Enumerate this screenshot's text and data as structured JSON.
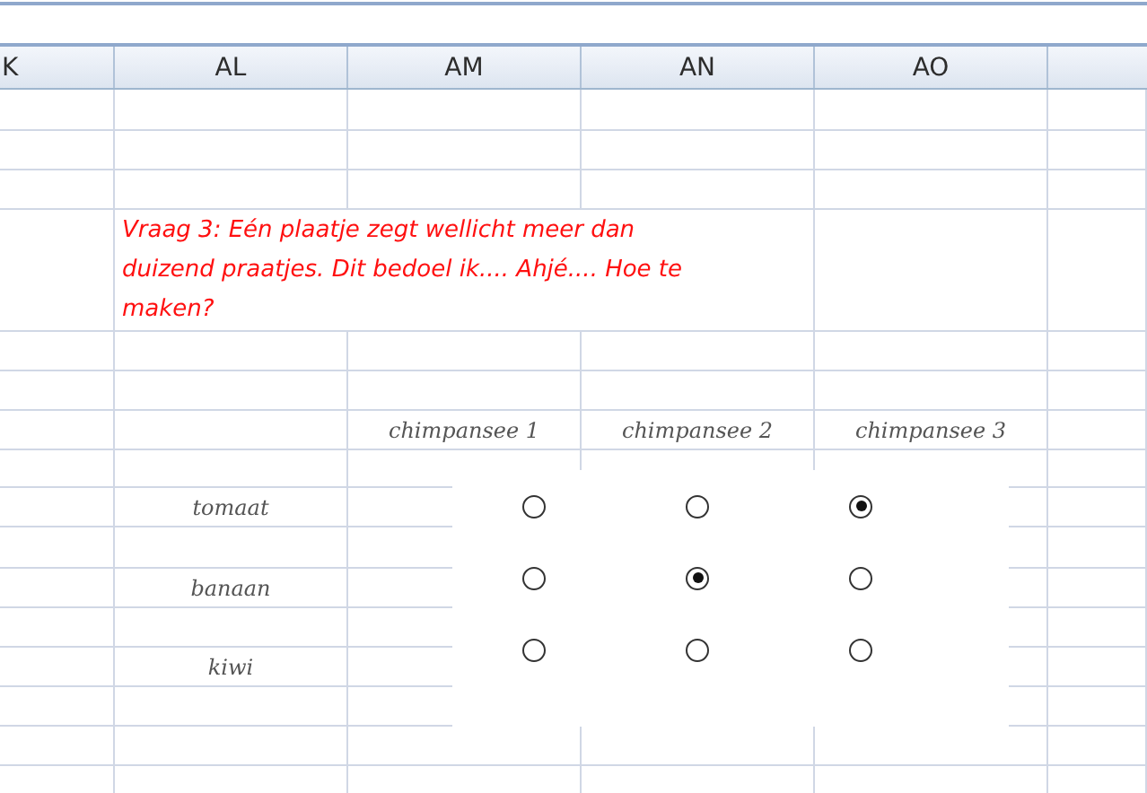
{
  "columns": [
    {
      "label": "K"
    },
    {
      "label": "AL"
    },
    {
      "label": "AM"
    },
    {
      "label": "AN"
    },
    {
      "label": "AO"
    }
  ],
  "question": "Vraag 3: Eén plaatje zegt wellicht meer dan duizend praatjes. Dit bedoel ik.... Ahjé.... Hoe te maken?",
  "option_headers": [
    "chimpansee 1",
    "chimpansee 2",
    "chimpansee 3"
  ],
  "items": [
    {
      "label": "tomaat",
      "options": [
        {
          "selected": false
        },
        {
          "selected": false
        },
        {
          "selected": true
        }
      ]
    },
    {
      "label": "banaan",
      "options": [
        {
          "selected": false
        },
        {
          "selected": true
        },
        {
          "selected": false
        }
      ]
    },
    {
      "label": "kiwi",
      "options": [
        {
          "selected": false
        },
        {
          "selected": false
        },
        {
          "selected": false
        }
      ]
    }
  ]
}
